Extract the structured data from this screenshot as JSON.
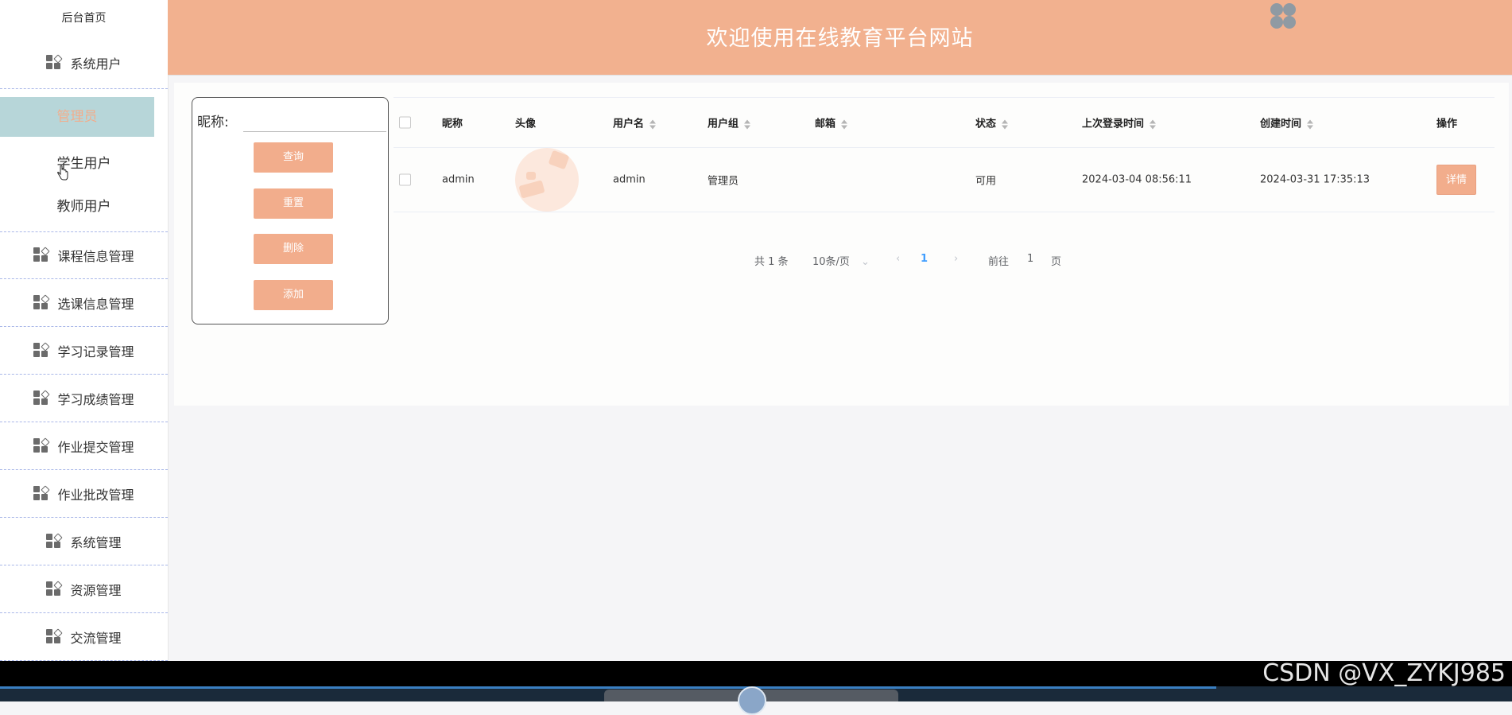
{
  "sidebar": {
    "home": "后台首页",
    "system_user_group": "系统用户",
    "sub_items": [
      "管理员",
      "学生用户",
      "教师用户"
    ],
    "menus": [
      "课程信息管理",
      "选课信息管理",
      "学习记录管理",
      "学习成绩管理",
      "作业提交管理",
      "作业批改管理",
      "系统管理",
      "资源管理",
      "交流管理"
    ]
  },
  "header": {
    "title": "欢迎使用在线教育平台网站"
  },
  "search": {
    "label": "昵称:",
    "value": "",
    "buttons": {
      "query": "查询",
      "reset": "重置",
      "delete": "删除",
      "add": "添加"
    }
  },
  "table": {
    "headers": {
      "nickname": "昵称",
      "avatar": "头像",
      "username": "用户名",
      "group": "用户组",
      "email": "邮箱",
      "status": "状态",
      "last_login": "上次登录时间",
      "created": "创建时间",
      "actions": "操作"
    },
    "rows": [
      {
        "nickname": "admin",
        "username": "admin",
        "group": "管理员",
        "email": "",
        "status": "可用",
        "last_login": "2024-03-04 08:56:11",
        "created": "2024-03-31 17:35:13",
        "action": "详情"
      }
    ]
  },
  "pagination": {
    "total": "共 1 条",
    "page_size": "10条/页",
    "current_page": "1",
    "goto_prefix": "前往",
    "goto_value": "1",
    "goto_suffix": "页"
  },
  "watermark": "CSDN @VX_ZYKJ985",
  "colors": {
    "accent": "#f2ad8c",
    "header_bg": "#f2b18f",
    "active_menu_bg": "#b7d6d9",
    "page_link": "#409eff"
  }
}
